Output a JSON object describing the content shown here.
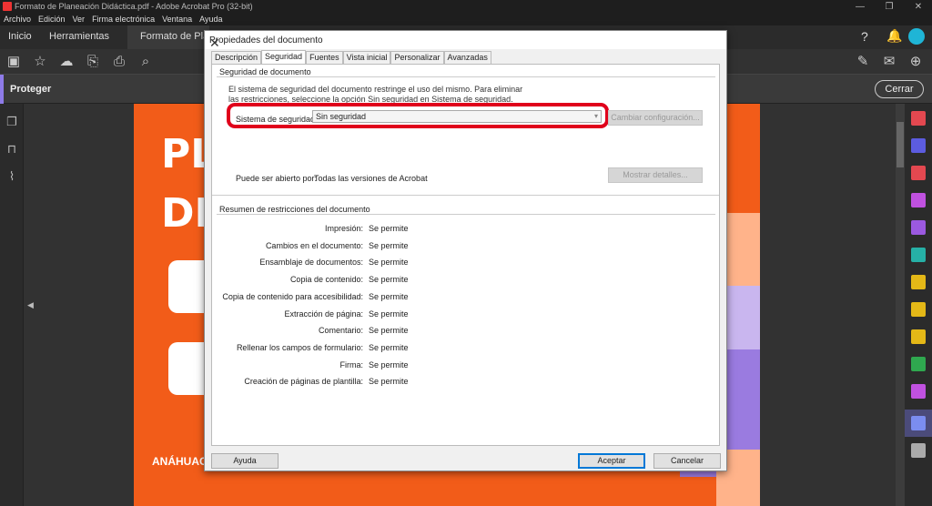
{
  "window": {
    "title": "Formato de Planeación Didáctica.pdf - Adobe Acrobat Pro (32-bit)",
    "controls": [
      "—",
      "❐",
      "✕"
    ]
  },
  "menu": [
    "Archivo",
    "Edición",
    "Ver",
    "Firma electrónica",
    "Ventana",
    "Ayuda"
  ],
  "tabs": {
    "home": "Inicio",
    "tools": "Herramientas",
    "document": "Formato de Planea"
  },
  "protect": {
    "label": "Proteger",
    "close": "Cerrar"
  },
  "pdf": {
    "big1": "PL",
    "big2": "DI",
    "brand": "ANÁHUAC",
    "colors": {
      "orange": "#f25c19",
      "purple": "#9a7be0"
    }
  },
  "dialog": {
    "title": "Propiedades del documento",
    "tabs": [
      "Descripción",
      "Seguridad",
      "Fuentes",
      "Vista inicial",
      "Personalizar",
      "Avanzadas"
    ],
    "selected_tab": "Seguridad",
    "security_section": "Seguridad de documento",
    "message": "El sistema de seguridad del documento restringe el uso del mismo. Para eliminar las restricciones, seleccione la opción Sin seguridad en Sistema de seguridad.",
    "system_label": "Sistema de seguridad:",
    "system_value": "Sin seguridad",
    "change_settings": "Cambiar configuración...",
    "open_label": "Puede ser abierto por:",
    "open_value": "Todas las versiones de Acrobat",
    "show_details": "Mostrar detalles...",
    "restrictions_title": "Resumen de restricciones del documento",
    "restrictions": [
      {
        "label": "Impresión:",
        "value": "Se permite"
      },
      {
        "label": "Cambios en el documento:",
        "value": "Se permite"
      },
      {
        "label": "Ensamblaje de documentos:",
        "value": "Se permite"
      },
      {
        "label": "Copia de contenido:",
        "value": "Se permite"
      },
      {
        "label": "Copia de contenido para accesibilidad:",
        "value": "Se permite"
      },
      {
        "label": "Extracción de página:",
        "value": "Se permite"
      },
      {
        "label": "Comentario:",
        "value": "Se permite"
      },
      {
        "label": "Rellenar los campos de formulario:",
        "value": "Se permite"
      },
      {
        "label": "Firma:",
        "value": "Se permite"
      },
      {
        "label": "Creación de páginas de plantilla:",
        "value": "Se permite"
      }
    ],
    "help": "Ayuda",
    "ok": "Aceptar",
    "cancel": "Cancelar"
  }
}
